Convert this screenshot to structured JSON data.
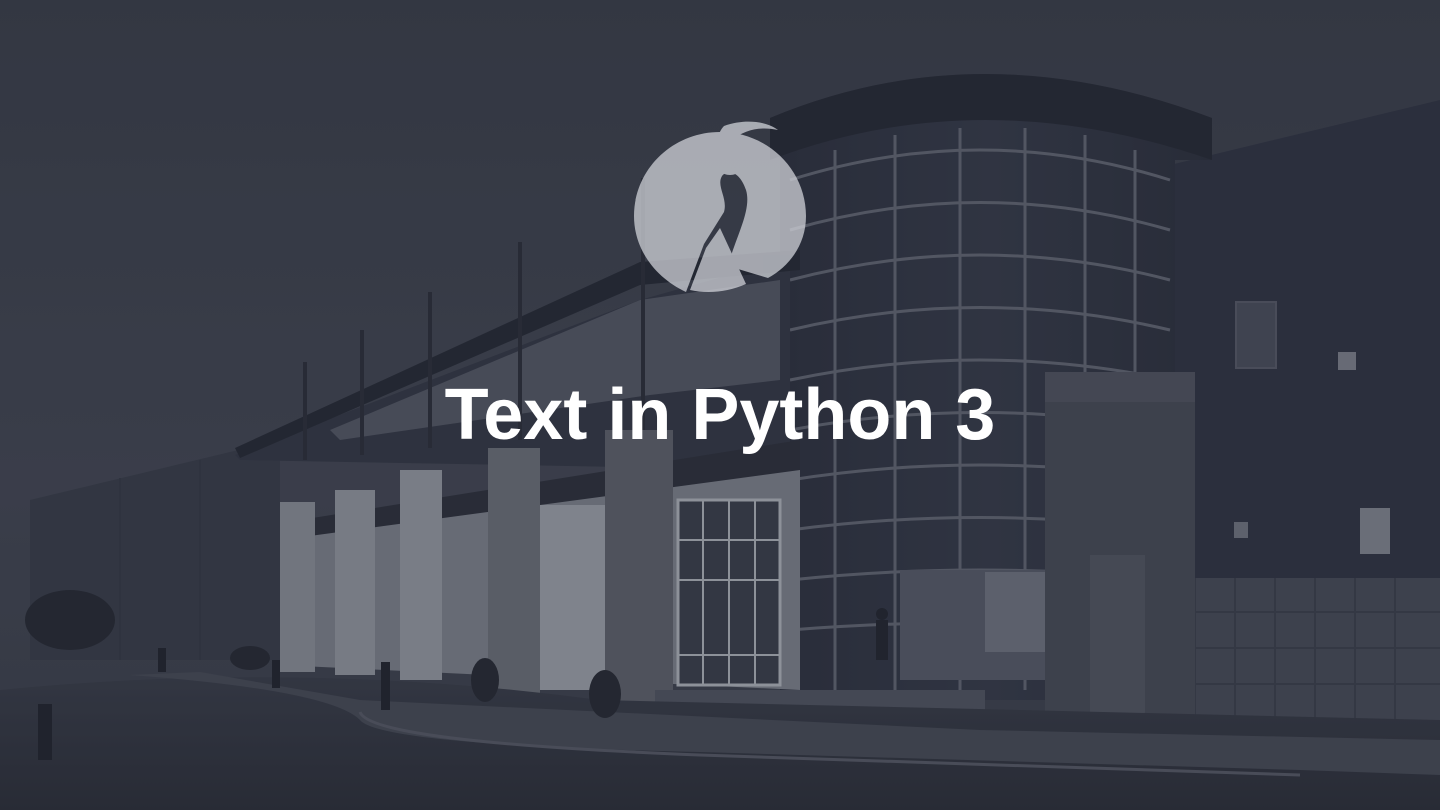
{
  "slide": {
    "title": "Text in Python 3",
    "background": "photo of a modern building with a curved glass facade at dusk, darkened with a blue-grey overlay",
    "logo_icon": "person-raising-arm-logo-icon"
  },
  "colors": {
    "overlay": "#262a38",
    "title_text": "#ffffff",
    "logo_fill": "#c8cbd2"
  }
}
